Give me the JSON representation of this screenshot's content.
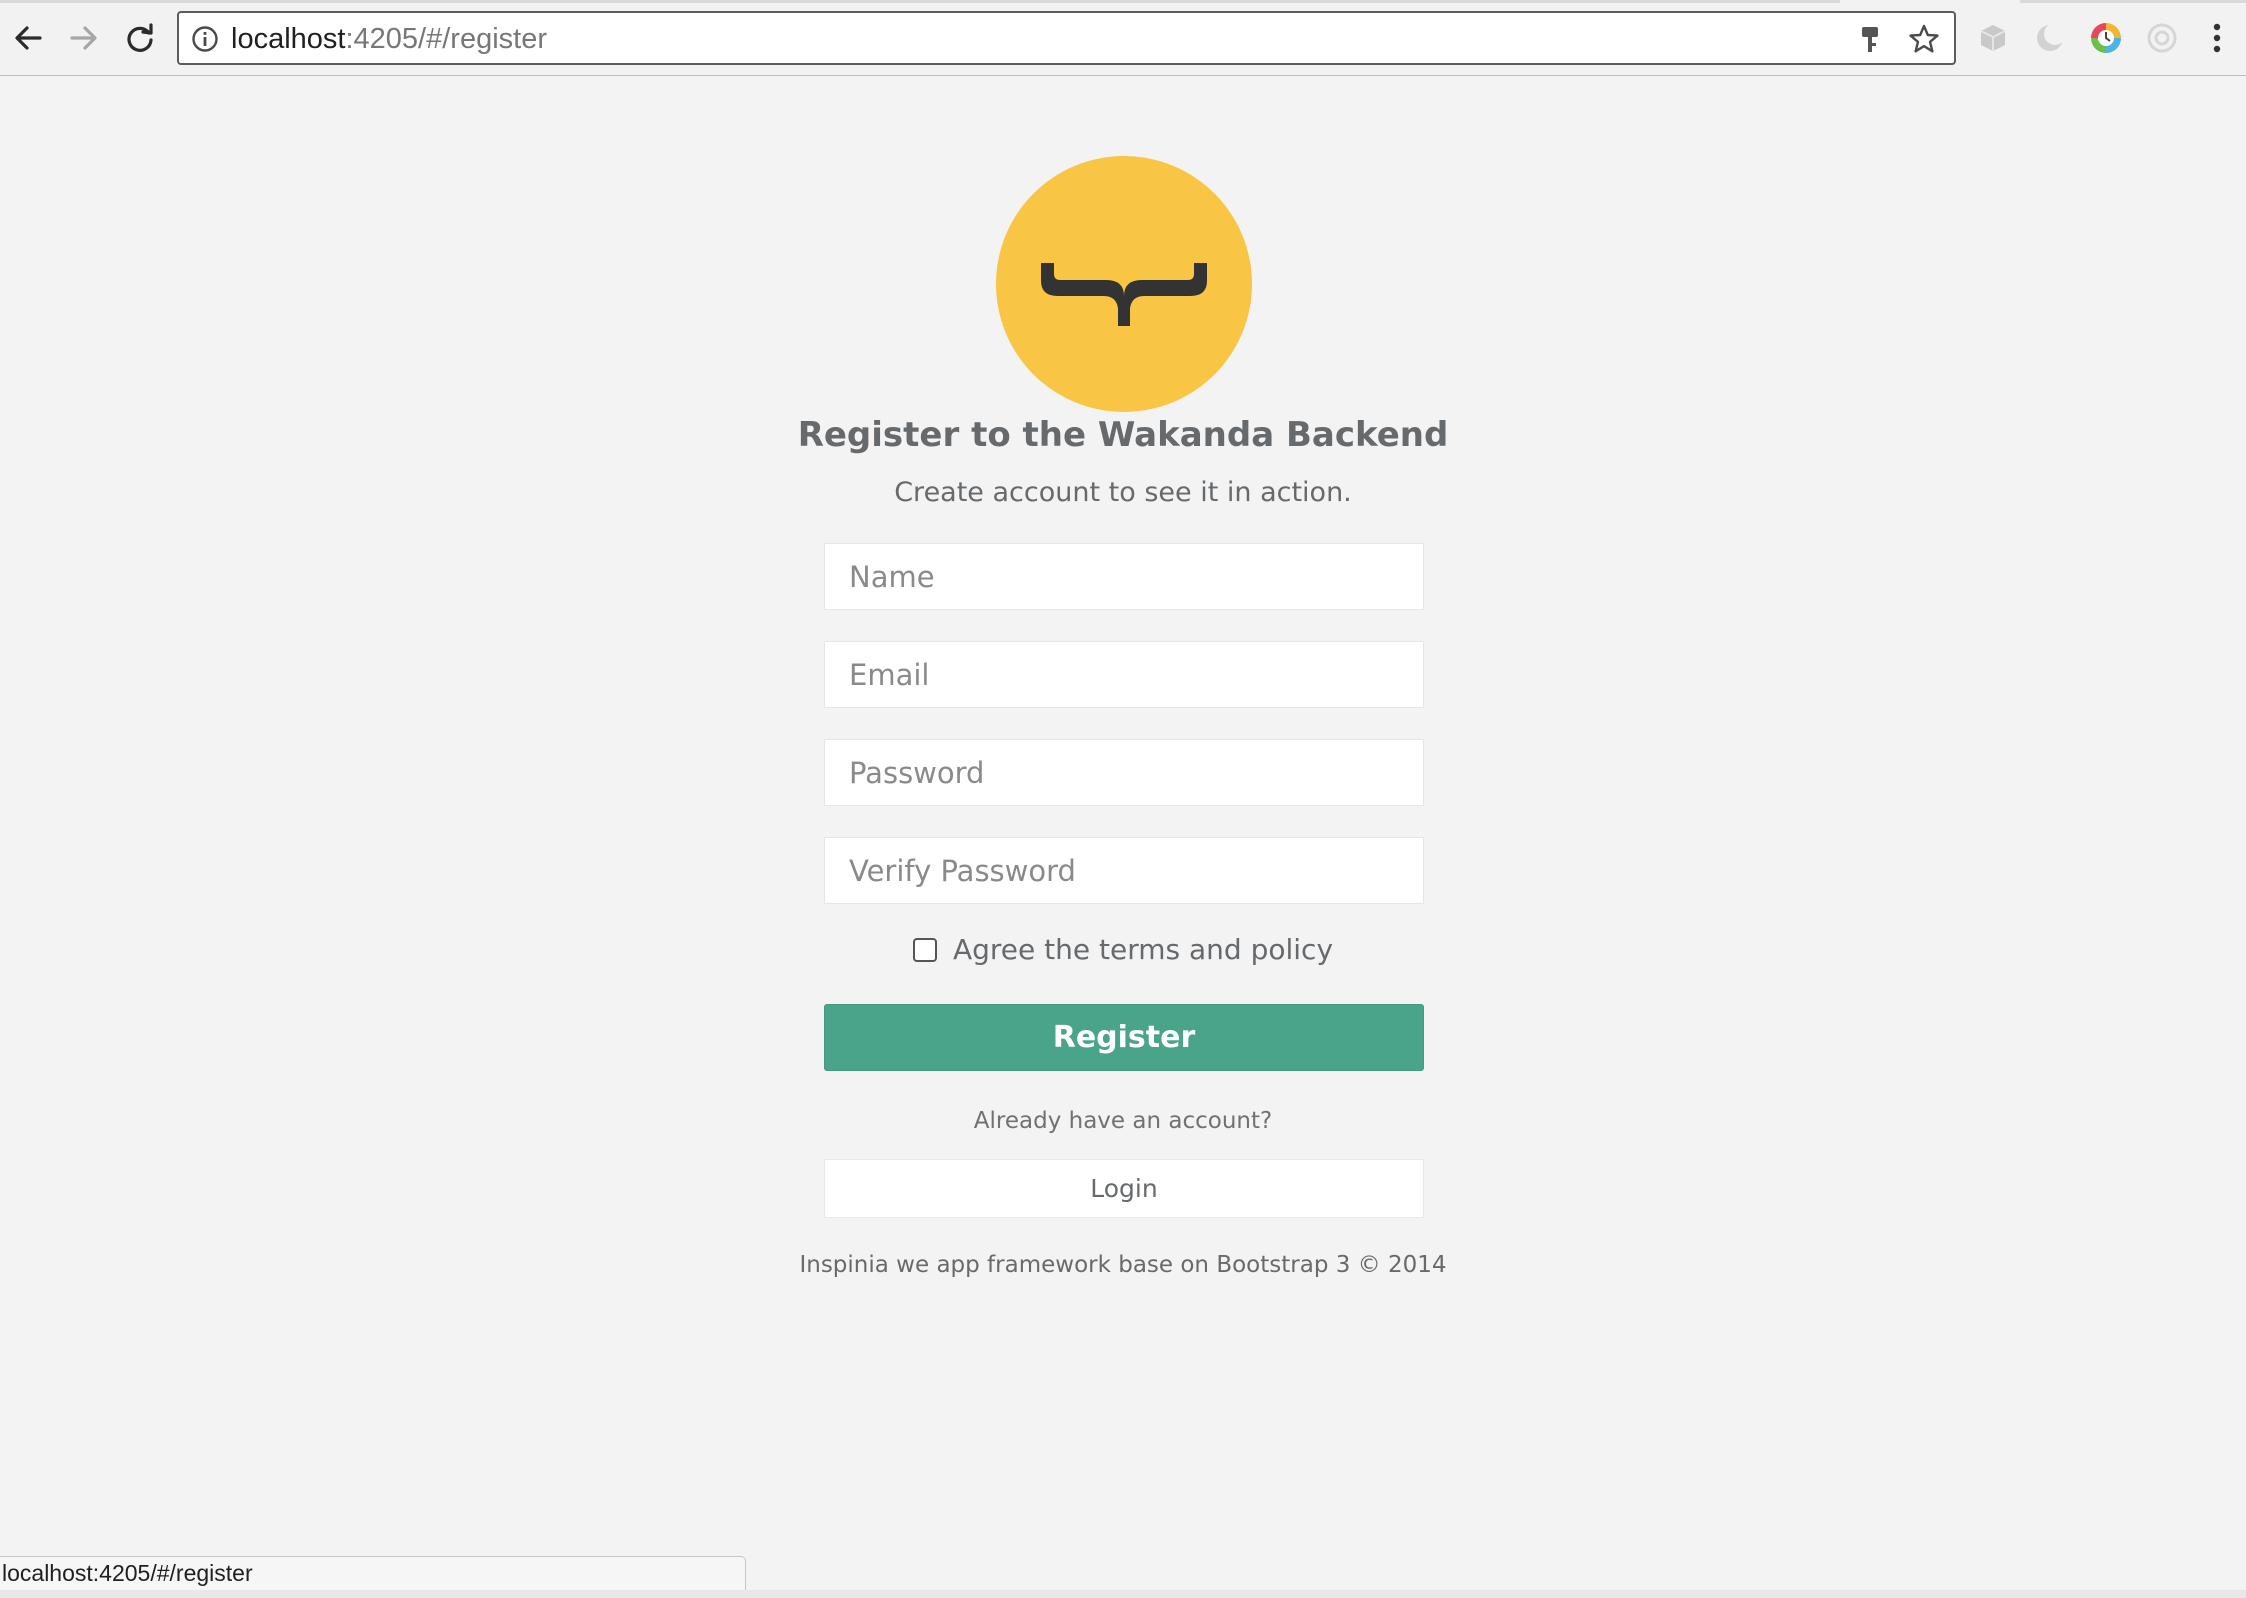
{
  "browser": {
    "url_host": "localhost",
    "url_rest": ":4205/#/register",
    "status_url": "localhost:4205/#/register",
    "icons": {
      "back": "arrow-left-icon",
      "forward": "arrow-right-icon",
      "reload": "reload-icon",
      "site_info": "info-icon",
      "key": "key-icon",
      "bookmark": "star-icon",
      "extensions": [
        "cube-extension-icon",
        "moon-extension-icon",
        "color-wheel-extension-icon",
        "circle-extension-icon"
      ],
      "menu": "kebab-menu-icon"
    }
  },
  "register": {
    "logo_icon": "wakanda-brace-logo",
    "title": "Register to the Wakanda Backend",
    "subtitle": "Create account to see it in action.",
    "fields": {
      "name_placeholder": "Name",
      "email_placeholder": "Email",
      "password_placeholder": "Password",
      "verify_placeholder": "Verify Password"
    },
    "agree_label": "Agree the terms and policy",
    "agree_checked": false,
    "register_button": "Register",
    "already_text": "Already have an account?",
    "login_button": "Login",
    "footer": "Inspinia we app framework base on Bootstrap 3 © 2014"
  },
  "colors": {
    "background": "#f3f3f4",
    "logo_yellow": "#f8c544",
    "primary_green": "#4aa48a",
    "text": "#676a6c"
  }
}
